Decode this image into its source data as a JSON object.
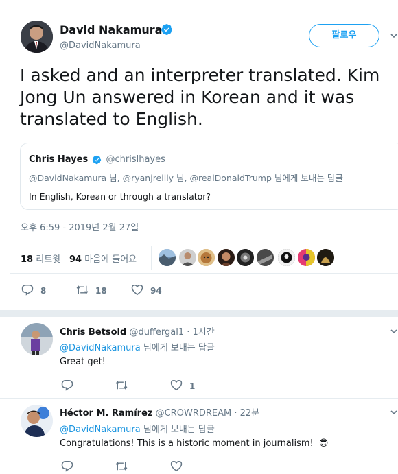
{
  "main_tweet": {
    "author_name": "David Nakamura",
    "author_handle": "@DavidNakamura",
    "follow_label": "팔로우",
    "text_line1": "I asked and an interpreter translated. Kim",
    "text_line2": "Jong Un answered in Korean and it was",
    "text_line3": "translated to English.",
    "timestamp": "오후 6:59 - 2019년 2월 27일",
    "retweets_count": "18",
    "retweets_label": "리트윗",
    "likes_count": "94",
    "likes_label": "마음에 들어요",
    "actions": {
      "reply": "8",
      "retweet": "18",
      "like": "94"
    }
  },
  "quoted_tweet": {
    "author_name": "Chris Hayes",
    "author_handle": "@chrislhayes",
    "reply_to": "@DavidNakamura 님, @ryanjreilly 님, @realDonaldTrump 님에게 보내는 답글",
    "text": "In English, Korean or through a translator?"
  },
  "replies": [
    {
      "author_name": "Chris Betsold",
      "author_handle": "@duffergal1",
      "time": "· 1시간",
      "reply_to_handle": "@DavidNakamura",
      "reply_to_suffix": "님에게 보내는 답글",
      "text": "Great get!",
      "like_count": "1"
    },
    {
      "author_name": "Héctor M. Ramírez",
      "author_handle": "@CROWRDREAM",
      "time": "· 22분",
      "reply_to_handle": "@DavidNakamura",
      "reply_to_suffix": "님에게 보내는 답글",
      "text": "Congratulations! This is a historic moment in journalism!",
      "emoji": "😎"
    }
  ],
  "colors": {
    "accent": "#1da1f2",
    "link": "#1b95e0",
    "muted": "#657786",
    "divider": "#e6ecf0"
  },
  "icons": [
    "verified-badge-icon",
    "chevron-down-icon",
    "reply-icon",
    "retweet-icon",
    "heart-icon"
  ]
}
